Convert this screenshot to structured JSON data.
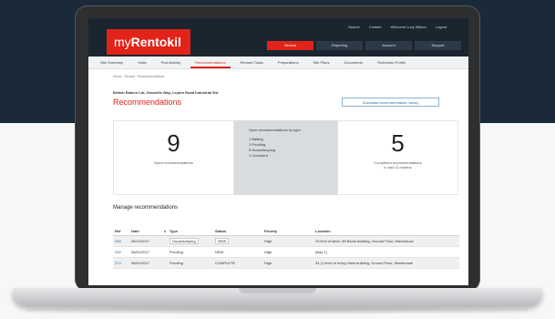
{
  "app": {
    "logo_prefix": "my",
    "logo_brand": "Rentokil"
  },
  "top_links": [
    "Search",
    "Contact",
    "Welcome Lucy Wilson",
    "Logout"
  ],
  "main_nav": [
    "Service",
    "Reporting",
    "Account",
    "Support"
  ],
  "main_nav_active": "Service",
  "sub_nav": [
    "Site Summary",
    "Visits",
    "Pest Activity",
    "Recommendations",
    "Remote Tasks",
    "Preparations",
    "Site Plans",
    "Documents",
    "Technician Profile"
  ],
  "sub_nav_active": "Recommendations",
  "breadcrumb": "Home · Service · Recommendations",
  "site_address": "British Rakers Ltd, Granville Way, Leyton Road Industrial Est",
  "page_title": "Recommendations",
  "download_label": "Download recommendation history",
  "stats": {
    "open_count": "9",
    "open_label": "Open recommendations",
    "by_type_title": "Open recommendations by type",
    "by_type": [
      "1 Baiting",
      "1 Proofing",
      "6 Housekeeping",
      "1 Comment"
    ],
    "completed_count": "5",
    "completed_label_line1": "Completed recommendations",
    "completed_label_line2": "in last 12 months"
  },
  "manage_title": "Manage recommendations",
  "table": {
    "headers": [
      "Ref",
      "Date",
      "v",
      "Type",
      "Status",
      "Priority",
      "Location"
    ],
    "rows": [
      {
        "ref": "265",
        "date": "08/12/2017",
        "type": "Housekeeping",
        "status": "NEW",
        "priority": "High",
        "location": "29 End of label, Wt Block building, Ground Floor, Warehouse"
      },
      {
        "ref": "265",
        "date": "08/01/2017",
        "type": "Proofing",
        "status": "NEW",
        "priority": "High",
        "location": "(Bay 1)"
      },
      {
        "ref": "274",
        "date": "08/01/2017",
        "type": "Proofing",
        "status": "COMPLETE",
        "priority": "High",
        "location": "34 (1 level of entry) Main building, Ground Floor, Warehouse"
      }
    ]
  },
  "colors": {
    "brand_red": "#e2231a",
    "nav_dark": "#1b2530",
    "page_dark": "#1b2a38"
  }
}
